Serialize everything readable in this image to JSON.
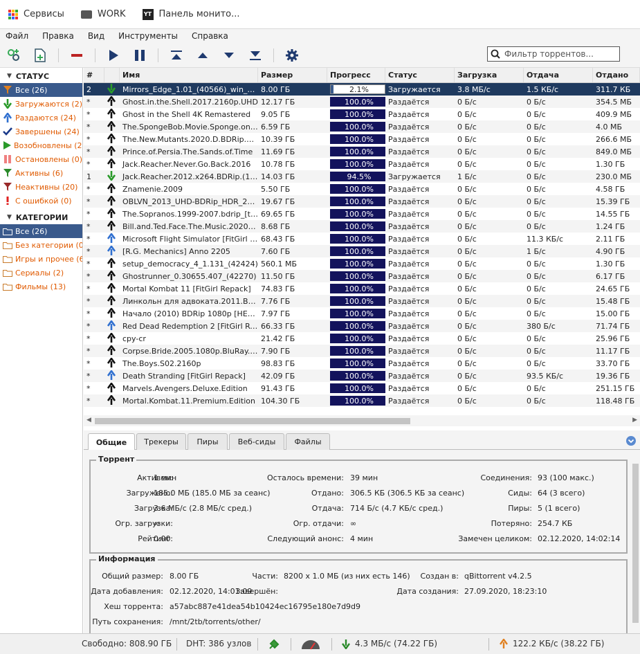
{
  "bookmarks": [
    {
      "label": "Сервисы",
      "icon": "apps-grid-icon"
    },
    {
      "label": "WORK",
      "icon": "folder-icon"
    },
    {
      "label": "Панель монито...",
      "icon": "yt-icon"
    }
  ],
  "menu": [
    "Файл",
    "Правка",
    "Вид",
    "Инструменты",
    "Справка"
  ],
  "filter": {
    "placeholder": "Фильтр торрентов..."
  },
  "sidebar": {
    "status_header": "СТАТУС",
    "status_items": [
      {
        "label": "Все (26)",
        "icon": "funnel-icon",
        "color": "#e08020",
        "selected": true
      },
      {
        "label": "Загружаются (2)",
        "icon": "download-arrow-icon",
        "color": "#2a9a2a"
      },
      {
        "label": "Раздаются (24)",
        "icon": "upload-arrow-icon",
        "color": "#3070d0"
      },
      {
        "label": "Завершены (24)",
        "icon": "check-icon",
        "color": "#1a3a8a"
      },
      {
        "label": "Возобновлены (26)",
        "icon": "play-icon",
        "color": "#2a9a2a"
      },
      {
        "label": "Остановлены (0)",
        "icon": "pause-icon",
        "color": "#f08080"
      },
      {
        "label": "Активны (6)",
        "icon": "funnel-active-icon",
        "color": "#2a8a2a"
      },
      {
        "label": "Неактивны (20)",
        "icon": "funnel-inactive-icon",
        "color": "#9a2a2a"
      },
      {
        "label": "С ошибкой (0)",
        "icon": "error-icon",
        "color": "#e02020"
      }
    ],
    "categories_header": "КАТЕГОРИИ",
    "category_items": [
      {
        "label": "Все (26)",
        "selected": true
      },
      {
        "label": "Без категории (0)"
      },
      {
        "label": "Игры и прочее (6)"
      },
      {
        "label": "Сериалы (2)"
      },
      {
        "label": "Фильмы (13)"
      }
    ]
  },
  "table": {
    "columns": [
      "#",
      "",
      "Имя",
      "Размер",
      "Прогресс",
      "Статус",
      "Загрузка",
      "Отдача",
      "Отдано"
    ],
    "rows": [
      {
        "n": "2",
        "dir": "down",
        "name": "Mirrors_Edge_1.01_(40566)_win_gog",
        "size": "8.00 ГБ",
        "progress": "2.1%",
        "pct": 2.1,
        "status": "Загружается",
        "dl": "3.8 МБ/с",
        "ul": "1.5 КБ/с",
        "sent": "311.7 КБ",
        "selected": true
      },
      {
        "n": "*",
        "dir": "up",
        "name": "Ghost.in.the.Shell.2017.2160p.UHD",
        "size": "12.17 ГБ",
        "progress": "100.0%",
        "pct": 100,
        "status": "Раздаётся",
        "dl": "0 Б/с",
        "ul": "0 Б/с",
        "sent": "354.5 МБ"
      },
      {
        "n": "*",
        "dir": "up",
        "name": "Ghost in the Shell 4K Remastered",
        "size": "9.05 ГБ",
        "progress": "100.0%",
        "pct": 100,
        "status": "Раздаётся",
        "dl": "0 Б/с",
        "ul": "0 Б/с",
        "sent": "409.9 МБ"
      },
      {
        "n": "*",
        "dir": "up",
        "name": "The.SpongeBob.Movie.Sponge.on.the.Run",
        "size": "6.59 ГБ",
        "progress": "100.0%",
        "pct": 100,
        "status": "Раздаётся",
        "dl": "0 Б/с",
        "ul": "0 Б/с",
        "sent": "4.0 МБ"
      },
      {
        "n": "*",
        "dir": "up",
        "name": "The.New.Mutants.2020.D.BDRip.1080p",
        "size": "10.39 ГБ",
        "progress": "100.0%",
        "pct": 100,
        "status": "Раздаётся",
        "dl": "0 Б/с",
        "ul": "0 Б/с",
        "sent": "266.6 МБ"
      },
      {
        "n": "*",
        "dir": "up",
        "name": "Prince.of.Persia.The.Sands.of.Time",
        "size": "11.69 ГБ",
        "progress": "100.0%",
        "pct": 100,
        "status": "Раздаётся",
        "dl": "0 Б/с",
        "ul": "0 Б/с",
        "sent": "849.0 МБ"
      },
      {
        "n": "*",
        "dir": "up",
        "name": "Jack.Reacher.Never.Go.Back.2016",
        "size": "10.78 ГБ",
        "progress": "100.0%",
        "pct": 100,
        "status": "Раздаётся",
        "dl": "0 Б/с",
        "ul": "0 Б/с",
        "sent": "1.30 ГБ"
      },
      {
        "n": "1",
        "dir": "down",
        "name": "Jack.Reacher.2012.x264.BDRip.(1080p)",
        "size": "14.03 ГБ",
        "progress": "94.5%",
        "pct": 94.5,
        "status": "Загружается",
        "dl": "1 Б/с",
        "ul": "0 Б/с",
        "sent": "230.0 МБ"
      },
      {
        "n": "*",
        "dir": "up",
        "name": "Znamenie.2009",
        "size": "5.50 ГБ",
        "progress": "100.0%",
        "pct": 100,
        "status": "Раздаётся",
        "dl": "0 Б/с",
        "ul": "0 Б/с",
        "sent": "4.58 ГБ"
      },
      {
        "n": "*",
        "dir": "up",
        "name": "OBLVN_2013_UHD-BDRip_HDR_2160p",
        "size": "19.67 ГБ",
        "progress": "100.0%",
        "pct": 100,
        "status": "Раздаётся",
        "dl": "0 Б/с",
        "ul": "0 Б/с",
        "sent": "15.39 ГБ"
      },
      {
        "n": "*",
        "dir": "up",
        "name": "The.Sopranos.1999-2007.bdrip_[teko]",
        "size": "69.65 ГБ",
        "progress": "100.0%",
        "pct": 100,
        "status": "Раздаётся",
        "dl": "0 Б/с",
        "ul": "0 Б/с",
        "sent": "14.55 ГБ"
      },
      {
        "n": "*",
        "dir": "up",
        "name": "Bill.and.Ted.Face.The.Music.2020.BDRip",
        "size": "8.68 ГБ",
        "progress": "100.0%",
        "pct": 100,
        "status": "Раздаётся",
        "dl": "0 Б/с",
        "ul": "0 Б/с",
        "sent": "1.24 ГБ"
      },
      {
        "n": "*",
        "dir": "upb",
        "name": "Microsoft Flight Simulator [FitGirl Repack]",
        "size": "68.43 ГБ",
        "progress": "100.0%",
        "pct": 100,
        "status": "Раздаётся",
        "dl": "0 Б/с",
        "ul": "11.3 КБ/с",
        "sent": "2.11 ГБ"
      },
      {
        "n": "*",
        "dir": "upb",
        "name": "[R.G. Mechanics] Anno 2205",
        "size": "7.60 ГБ",
        "progress": "100.0%",
        "pct": 100,
        "status": "Раздаётся",
        "dl": "0 Б/с",
        "ul": "1 Б/с",
        "sent": "4.90 ГБ"
      },
      {
        "n": "*",
        "dir": "up",
        "name": "setup_democracy_4_1.131_(42424)",
        "size": "560.1 МБ",
        "progress": "100.0%",
        "pct": 100,
        "status": "Раздаётся",
        "dl": "0 Б/с",
        "ul": "0 Б/с",
        "sent": "1.30 ГБ"
      },
      {
        "n": "*",
        "dir": "up",
        "name": "Ghostrunner_0.30655.407_(42270)",
        "size": "11.50 ГБ",
        "progress": "100.0%",
        "pct": 100,
        "status": "Раздаётся",
        "dl": "0 Б/с",
        "ul": "0 Б/с",
        "sent": "6.17 ГБ"
      },
      {
        "n": "*",
        "dir": "up",
        "name": "Mortal Kombat 11 [FitGirl Repack]",
        "size": "74.83 ГБ",
        "progress": "100.0%",
        "pct": 100,
        "status": "Раздаётся",
        "dl": "0 Б/с",
        "ul": "0 Б/с",
        "sent": "24.65 ГБ"
      },
      {
        "n": "*",
        "dir": "up",
        "name": "Линкольн для адвоката.2011.BDRip",
        "size": "7.76 ГБ",
        "progress": "100.0%",
        "pct": 100,
        "status": "Раздаётся",
        "dl": "0 Б/с",
        "ul": "0 Б/с",
        "sent": "15.48 ГБ"
      },
      {
        "n": "*",
        "dir": "up",
        "name": "Начало (2010) BDRip 1080p [HEVC]",
        "size": "7.97 ГБ",
        "progress": "100.0%",
        "pct": 100,
        "status": "Раздаётся",
        "dl": "0 Б/с",
        "ul": "0 Б/с",
        "sent": "15.00 ГБ"
      },
      {
        "n": "*",
        "dir": "upb",
        "name": "Red Dead Redemption 2 [FitGirl Repack]",
        "size": "66.33 ГБ",
        "progress": "100.0%",
        "pct": 100,
        "status": "Раздаётся",
        "dl": "0 Б/с",
        "ul": "380 Б/с",
        "sent": "71.74 ГБ"
      },
      {
        "n": "*",
        "dir": "up",
        "name": "cpy-cr",
        "size": "21.42 ГБ",
        "progress": "100.0%",
        "pct": 100,
        "status": "Раздаётся",
        "dl": "0 Б/с",
        "ul": "0 Б/с",
        "sent": "25.96 ГБ"
      },
      {
        "n": "*",
        "dir": "up",
        "name": "Corpse.Bride.2005.1080p.BluRay.x264",
        "size": "7.90 ГБ",
        "progress": "100.0%",
        "pct": 100,
        "status": "Раздаётся",
        "dl": "0 Б/с",
        "ul": "0 Б/с",
        "sent": "11.17 ГБ"
      },
      {
        "n": "*",
        "dir": "up",
        "name": "The.Boys.S02.2160p",
        "size": "98.83 ГБ",
        "progress": "100.0%",
        "pct": 100,
        "status": "Раздаётся",
        "dl": "0 Б/с",
        "ul": "0 Б/с",
        "sent": "33.70 ГБ"
      },
      {
        "n": "*",
        "dir": "upb",
        "name": "Death Stranding [FitGirl Repack]",
        "size": "42.09 ГБ",
        "progress": "100.0%",
        "pct": 100,
        "status": "Раздаётся",
        "dl": "0 Б/с",
        "ul": "93.5 КБ/с",
        "sent": "19.36 ГБ"
      },
      {
        "n": "*",
        "dir": "up",
        "name": "Marvels.Avengers.Deluxe.Edition",
        "size": "91.43 ГБ",
        "progress": "100.0%",
        "pct": 100,
        "status": "Раздаётся",
        "dl": "0 Б/с",
        "ul": "0 Б/с",
        "sent": "251.15 ГБ"
      },
      {
        "n": "*",
        "dir": "up",
        "name": "Mortal.Kombat.11.Premium.Edition",
        "size": "104.30 ГБ",
        "progress": "100.0%",
        "pct": 100,
        "status": "Раздаётся",
        "dl": "0 Б/с",
        "ul": "0 Б/с",
        "sent": "118.48 ГБ"
      }
    ]
  },
  "tabs": [
    "Общие",
    "Трекеры",
    "Пиры",
    "Веб-сиды",
    "Файлы"
  ],
  "details": {
    "torrent_title": "Торрент",
    "torrent_fields": [
      {
        "k": "Активен:",
        "v": "1 мин"
      },
      {
        "k": "Осталось времени:",
        "v": "39 мин"
      },
      {
        "k": "Соединения:",
        "v": "93 (100 макс.)"
      },
      {
        "k": "Загружено:",
        "v": "185.0 МБ (185.0 МБ за сеанс)"
      },
      {
        "k": "Отдано:",
        "v": "306.5 КБ (306.5 КБ за сеанс)"
      },
      {
        "k": "Сиды:",
        "v": "64 (3 всего)"
      },
      {
        "k": "Загрузка:",
        "v": "3.6 МБ/с (2.8 МБ/с сред.)"
      },
      {
        "k": "Отдача:",
        "v": "714 Б/с (4.7 КБ/с сред.)"
      },
      {
        "k": "Пиры:",
        "v": "5 (1 всего)"
      },
      {
        "k": "Огр. загрузки:",
        "v": "∞"
      },
      {
        "k": "Огр. отдачи:",
        "v": "∞"
      },
      {
        "k": "Потеряно:",
        "v": "254.7 КБ"
      },
      {
        "k": "Рейтинг:",
        "v": "0.00"
      },
      {
        "k": "Следующий анонс:",
        "v": "4 мин"
      },
      {
        "k": "Замечен целиком:",
        "v": "02.12.2020, 14:02:14"
      }
    ],
    "info_title": "Информация",
    "info_fields": [
      {
        "k": "Общий размер:",
        "v": "8.00 ГБ"
      },
      {
        "k": "Части:",
        "v": "8200 x 1.0 МБ (из них есть 146)"
      },
      {
        "k": "Создан в:",
        "v": "qBittorrent v4.2.5"
      },
      {
        "k": "Дата добавления:",
        "v": "02.12.2020, 14:01:09"
      },
      {
        "k": "Завершён:",
        "v": ""
      },
      {
        "k": "Дата создания:",
        "v": "27.09.2020, 18:23:10"
      },
      {
        "k": "Хеш торрента:",
        "v": "a57abc887e41dea54b10424ec16795e180e7d9d9"
      },
      {
        "k": "Путь сохранения:",
        "v": "/mnt/2tb/torrents/other/"
      }
    ]
  },
  "statusbar": {
    "free": "Свободно: 808.90 ГБ",
    "dht": "DHT: 386 узлов",
    "dl": "4.3 МБ/с (74.22 ГБ)",
    "ul": "122.2 КБ/с (38.22 ГБ)"
  },
  "colors": {
    "accent": "#3a5a8c",
    "bar": "#13135c",
    "selected_row": "#1f3a5f",
    "status_orange": "#e05a00"
  }
}
